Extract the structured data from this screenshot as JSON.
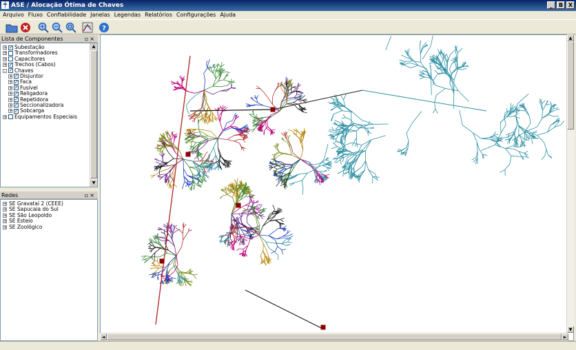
{
  "window": {
    "title": "ASE / Alocação Ótima de Chaves",
    "app_icon": "ase-grid-icon",
    "controls": [
      "_",
      "B",
      "X"
    ]
  },
  "menu": [
    "Arquivo",
    "Fluxo",
    "Confiabilidade",
    "Janelas",
    "Legendas",
    "Relatórios",
    "Configurações",
    "Ajuda"
  ],
  "toolbar": [
    "open-folder-icon",
    "stop-icon",
    "zoom-in-icon",
    "zoom-out-icon",
    "zoom-fit-icon",
    "map-layers-icon",
    "help-icon"
  ],
  "components_panel": {
    "title": "Lista de Componentes",
    "items": [
      {
        "label": "Subestação",
        "expander": "+",
        "checked": true,
        "indent": 0
      },
      {
        "label": "Transformadores",
        "expander": "+",
        "checked": false,
        "indent": 0
      },
      {
        "label": "Capacitores",
        "expander": "+",
        "checked": false,
        "indent": 0
      },
      {
        "label": "Trechos (Cabos)",
        "expander": "+",
        "checked": true,
        "indent": 0
      },
      {
        "label": "Chaves",
        "expander": "-",
        "checked": true,
        "indent": 0
      },
      {
        "label": "Disjuntor",
        "expander": "+",
        "checked": true,
        "indent": 1
      },
      {
        "label": "Faca",
        "expander": "+",
        "checked": true,
        "indent": 1
      },
      {
        "label": "Fusível",
        "expander": "+",
        "checked": true,
        "indent": 1
      },
      {
        "label": "Religadora",
        "expander": "+",
        "checked": true,
        "indent": 1
      },
      {
        "label": "Repetidora",
        "expander": "+",
        "checked": true,
        "indent": 1
      },
      {
        "label": "Seccionalizadora",
        "expander": "+",
        "checked": true,
        "indent": 1
      },
      {
        "label": "Sobcarga",
        "expander": "+",
        "checked": true,
        "indent": 1
      },
      {
        "label": "Equipamentos Especiais",
        "expander": "+",
        "checked": false,
        "indent": 0
      }
    ]
  },
  "networks_panel": {
    "title": "Redes",
    "items": [
      "SE Gravataí 2 (CEEE)",
      "SE Sapucaia do Sul",
      "SE São Leopoldo",
      "SE Esteio",
      "SE Zoológico"
    ]
  },
  "colors": {
    "title_bar": "#0a246a",
    "substation": "#8b0000",
    "feeders": [
      "#1a1a1a",
      "#2b8fa3",
      "#c0007a",
      "#1f3fbf",
      "#7a8a1a",
      "#b8860b",
      "#b03030",
      "#6a2a8a",
      "#3a8a3a"
    ]
  }
}
